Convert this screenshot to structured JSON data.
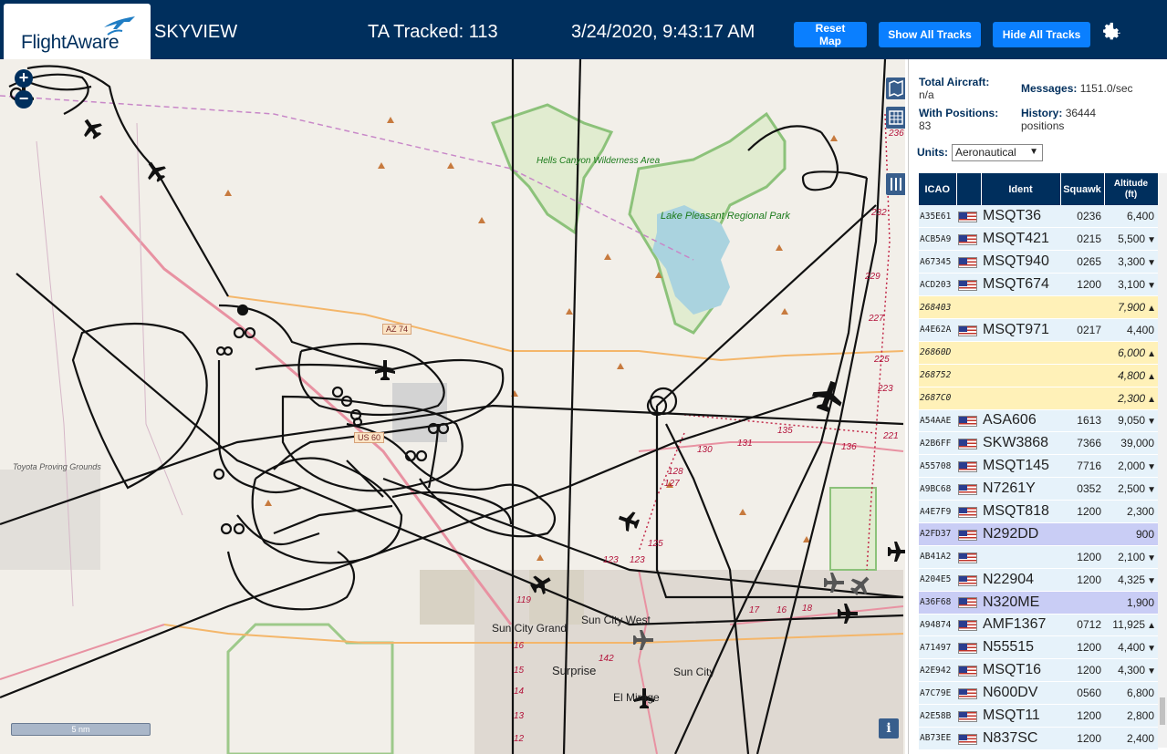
{
  "header": {
    "logo_text": "FlightAware",
    "app_title": "SKYVIEW",
    "ta_tracked": "TA Tracked: 113",
    "datetime": "3/24/2020, 9:43:17 AM",
    "reset_label": "Reset Map",
    "show_label": "Show All Tracks",
    "hide_label": "Hide All Tracks",
    "settings_icon": "gear-icon"
  },
  "colors": {
    "header_bg": "#002f5d",
    "button_bg": "#0a7fff",
    "track_color": "#111111",
    "row_default": "#e6f2fa",
    "row_no_ident": "#fff1b8",
    "row_selected": "#c9cdf5"
  },
  "map": {
    "labels": {
      "hells_canyon": "Hells Canyon Wilderness Area",
      "lake_pleasant": "Lake Pleasant Regional Park",
      "toyota": "Toyota Proving Grounds",
      "sun_city_grand": "Sun City Grand",
      "sun_city_west": "Sun City West",
      "surprise": "Surprise",
      "sun_city": "Sun City",
      "el_mirage": "El Mirage",
      "az74": "AZ 74",
      "us60": "US 60"
    },
    "route_numbers": [
      "236",
      "232",
      "229",
      "227",
      "225",
      "223",
      "221",
      "135",
      "131",
      "130",
      "136",
      "128",
      "127",
      "125",
      "123",
      "123",
      "119",
      "17",
      "16",
      "18",
      "15",
      "14",
      "13",
      "12",
      "16",
      "142"
    ],
    "scale_label": "5 nm",
    "info_label": "i",
    "zoom_in": "+",
    "zoom_out": "−"
  },
  "sidebar": {
    "total_aircraft_label": "Total Aircraft:",
    "total_aircraft_value": "n/a",
    "with_positions_label": "With Positions:",
    "with_positions_value": "83",
    "messages_label": "Messages:",
    "messages_value": "1151.0/sec",
    "history_label": "History:",
    "history_value": "36444",
    "history_unit": "positions",
    "units_label": "Units:",
    "units_value": "Aeronautical",
    "table_headers": {
      "icao": "ICAO",
      "ident": "Ident",
      "squawk": "Squawk",
      "altitude": "Altitude",
      "altitude_unit": "(ft)"
    },
    "rows": [
      {
        "icao": "A35E61",
        "flag": true,
        "ident": "MSQT36",
        "squawk": "0236",
        "alt": "6,400",
        "trend": "",
        "style": "row"
      },
      {
        "icao": "ACB5A9",
        "flag": true,
        "ident": "MSQT421",
        "squawk": "0215",
        "alt": "5,500",
        "trend": "▼",
        "style": "row"
      },
      {
        "icao": "A67345",
        "flag": true,
        "ident": "MSQT940",
        "squawk": "0265",
        "alt": "3,300",
        "trend": "▼",
        "style": "row"
      },
      {
        "icao": "ACD203",
        "flag": true,
        "ident": "MSQT674",
        "squawk": "1200",
        "alt": "3,100",
        "trend": "▼",
        "style": "row"
      },
      {
        "icao": "268403",
        "flag": false,
        "ident": "",
        "squawk": "",
        "alt": "7,900",
        "trend": "▲",
        "style": "yellow"
      },
      {
        "icao": "A4E62A",
        "flag": true,
        "ident": "MSQT971",
        "squawk": "0217",
        "alt": "4,400",
        "trend": "",
        "style": "row"
      },
      {
        "icao": "26860D",
        "flag": false,
        "ident": "",
        "squawk": "",
        "alt": "6,000",
        "trend": "▲",
        "style": "yellow"
      },
      {
        "icao": "268752",
        "flag": false,
        "ident": "",
        "squawk": "",
        "alt": "4,800",
        "trend": "▲",
        "style": "yellow"
      },
      {
        "icao": "2687C0",
        "flag": false,
        "ident": "",
        "squawk": "",
        "alt": "2,300",
        "trend": "▲",
        "style": "yellow"
      },
      {
        "icao": "A54AAE",
        "flag": true,
        "ident": "ASA606",
        "squawk": "1613",
        "alt": "9,050",
        "trend": "▼",
        "style": "row"
      },
      {
        "icao": "A2B6FF",
        "flag": true,
        "ident": "SKW3868",
        "squawk": "7366",
        "alt": "39,000",
        "trend": "",
        "style": "row"
      },
      {
        "icao": "A55708",
        "flag": true,
        "ident": "MSQT145",
        "squawk": "7716",
        "alt": "2,000",
        "trend": "▼",
        "style": "row"
      },
      {
        "icao": "A9BC68",
        "flag": true,
        "ident": "N7261Y",
        "squawk": "0352",
        "alt": "2,500",
        "trend": "▼",
        "style": "row"
      },
      {
        "icao": "A4E7F9",
        "flag": true,
        "ident": "MSQT818",
        "squawk": "1200",
        "alt": "2,300",
        "trend": "",
        "style": "row"
      },
      {
        "icao": "A2FD37",
        "flag": true,
        "ident": "N292DD",
        "squawk": "",
        "alt": "900",
        "trend": "",
        "style": "purple"
      },
      {
        "icao": "AB41A2",
        "flag": true,
        "ident": "",
        "squawk": "1200",
        "alt": "2,100",
        "trend": "▼",
        "style": "row"
      },
      {
        "icao": "A204E5",
        "flag": true,
        "ident": "N22904",
        "squawk": "1200",
        "alt": "4,325",
        "trend": "▼",
        "style": "row"
      },
      {
        "icao": "A36F68",
        "flag": true,
        "ident": "N320ME",
        "squawk": "",
        "alt": "1,900",
        "trend": "",
        "style": "purple"
      },
      {
        "icao": "A94874",
        "flag": true,
        "ident": "AMF1367",
        "squawk": "0712",
        "alt": "11,925",
        "trend": "▲",
        "style": "row"
      },
      {
        "icao": "A71497",
        "flag": true,
        "ident": "N55515",
        "squawk": "1200",
        "alt": "4,400",
        "trend": "▼",
        "style": "row"
      },
      {
        "icao": "A2E942",
        "flag": true,
        "ident": "MSQT16",
        "squawk": "1200",
        "alt": "4,300",
        "trend": "▼",
        "style": "row"
      },
      {
        "icao": "A7C79E",
        "flag": true,
        "ident": "N600DV",
        "squawk": "0560",
        "alt": "6,800",
        "trend": "",
        "style": "row"
      },
      {
        "icao": "A2E58B",
        "flag": true,
        "ident": "MSQT11",
        "squawk": "1200",
        "alt": "2,800",
        "trend": "",
        "style": "row"
      },
      {
        "icao": "AB73EE",
        "flag": true,
        "ident": "N837SC",
        "squawk": "1200",
        "alt": "2,400",
        "trend": "",
        "style": "row"
      }
    ]
  }
}
